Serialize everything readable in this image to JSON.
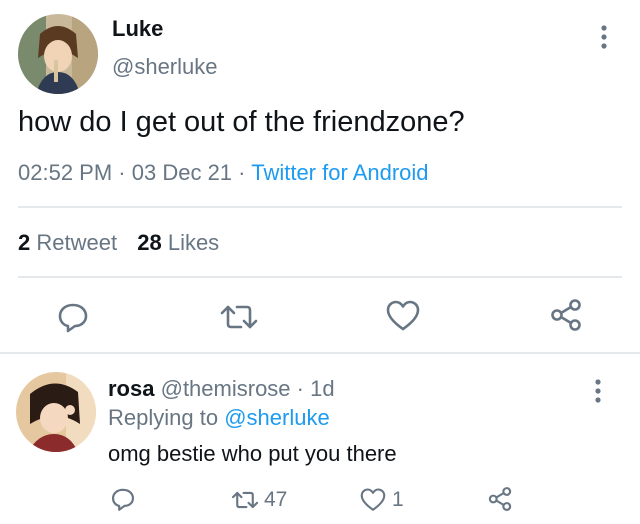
{
  "tweet": {
    "author_name": "Luke",
    "author_handle": "@sherluke",
    "text": "how do I get out of the friendzone?",
    "time": "02:52 PM",
    "date": "03 Dec 21",
    "dot": "·",
    "source": "Twitter for Android",
    "retweet_count": "2",
    "retweet_label": "Retweet",
    "like_count": "28",
    "like_label": "Likes",
    "more_icon": "more-vertical-icon",
    "actions": [
      "reply-icon",
      "retweet-icon",
      "like-icon",
      "share-icon"
    ]
  },
  "reply": {
    "author_name": "rosa",
    "author_handle": "@themisrose",
    "dot": "·",
    "age": "1d",
    "replying_prefix": "Replying to",
    "replying_handle": "@sherluke",
    "text": "omg bestie who put you there",
    "retweet_count": "47",
    "like_count": "1",
    "more_icon": "more-vertical-icon"
  },
  "colors": {
    "accent": "#1d9bf0",
    "muted": "#687684",
    "text": "#0f1419",
    "divider": "#e6e9ec"
  }
}
